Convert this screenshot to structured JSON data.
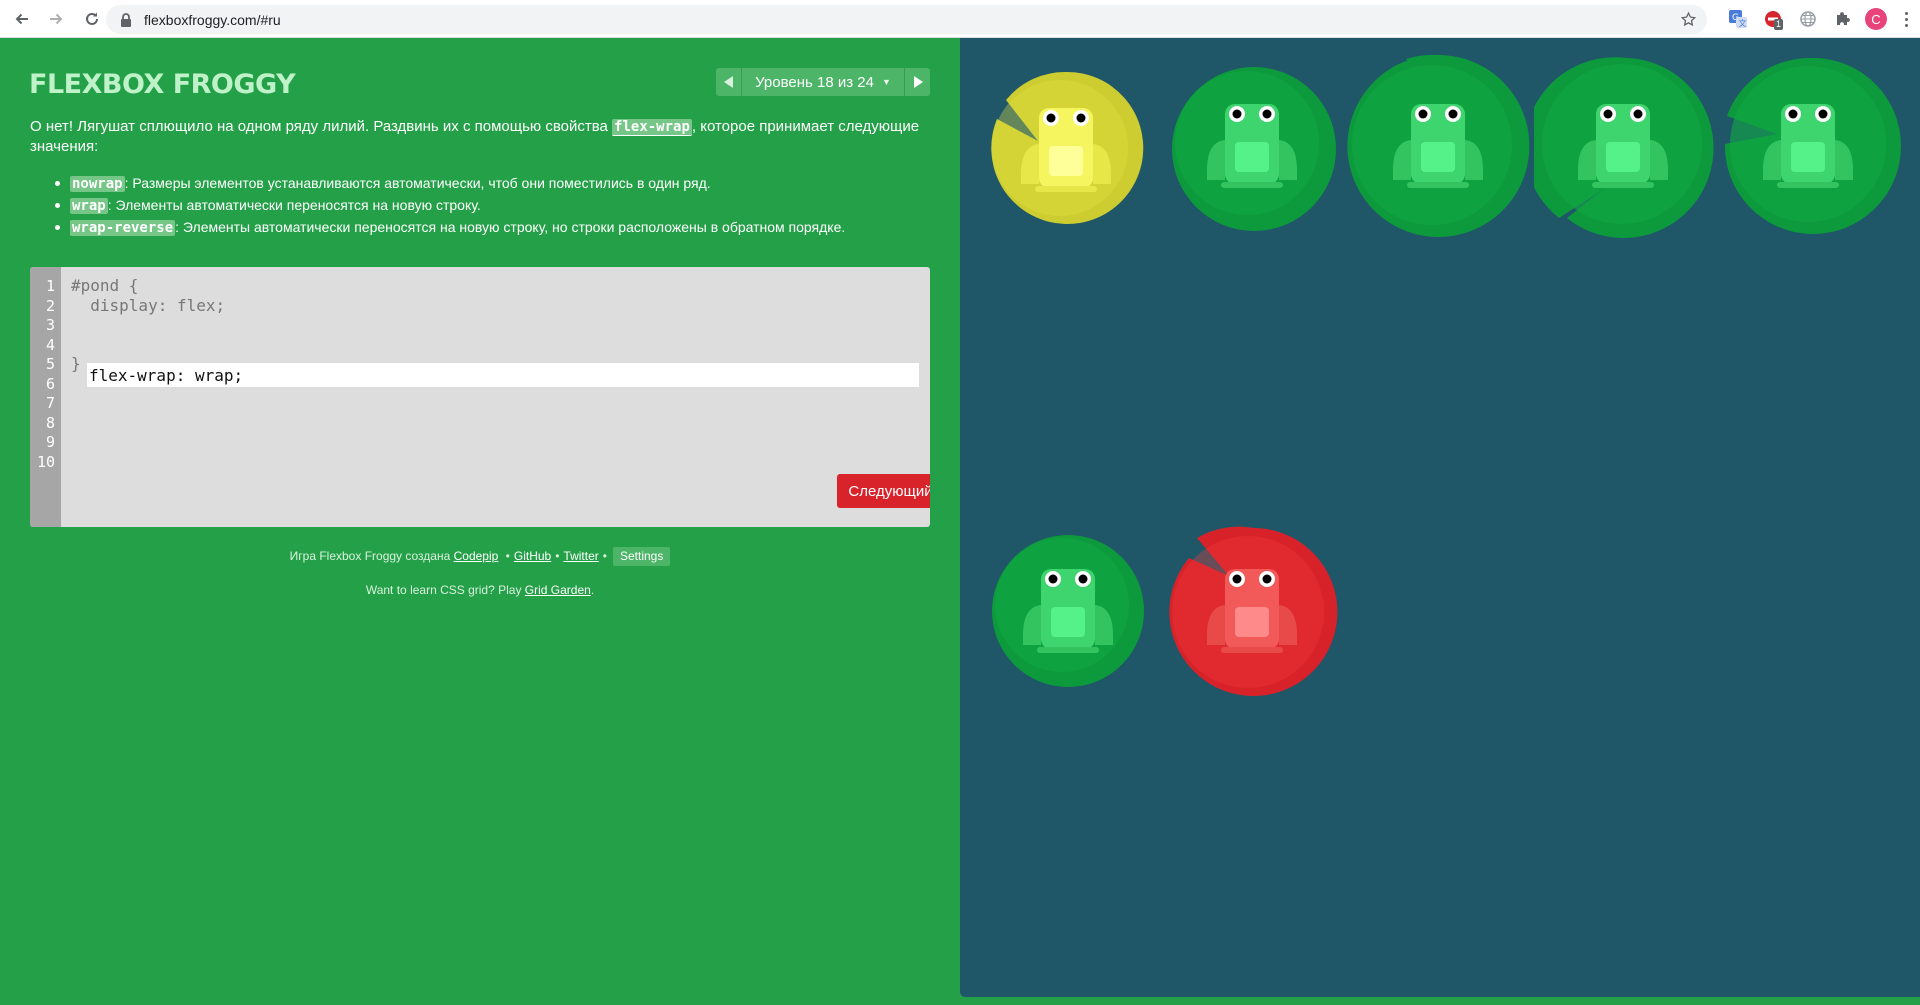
{
  "browser": {
    "url": "flexboxfroggy.com/#ru",
    "profile_initial": "C",
    "icons": [
      "back-icon",
      "forward-icon",
      "reload-icon",
      "lock-icon",
      "star-icon",
      "translate-extension-icon",
      "adblock-extension-icon",
      "globe-extension-icon",
      "puzzle-extensions-icon",
      "menu-icon"
    ],
    "adblock_badge": "1"
  },
  "game": {
    "logo": "FLEXBOX FROGGY",
    "level": {
      "label": "Уровень 18 из 24",
      "current": 18,
      "total": 24
    },
    "instructions": {
      "intro_before": "О нет! Лягушат сплющило на одном ряду лилий. Раздвинь их с помощью свойства ",
      "intro_property": "flex-wrap",
      "intro_after": ", которое принимает следующие значения:",
      "values": [
        {
          "code": "nowrap",
          "text": ": Размеры элементов устанавливаются автоматически, чтоб они поместились в один ряд."
        },
        {
          "code": "wrap",
          "text": ": Элементы автоматически переносятся на новую строку."
        },
        {
          "code": "wrap-reverse",
          "text": ": Элементы автоматически переносятся на новую строку, но строки расположены в обратном порядке."
        }
      ]
    },
    "editor": {
      "line_numbers": [
        "1",
        "2",
        "3",
        "4",
        "5",
        "6",
        "7",
        "8",
        "9",
        "10"
      ],
      "line1": "#pond {",
      "line2": "  display: flex;",
      "input_value": "flex-wrap: wrap;",
      "line4": "}",
      "next_button": "Следующий"
    },
    "credits": {
      "prefix": "Игра Flexbox Froggy создана",
      "codepip": "Codepip",
      "github": "GitHub",
      "twitter": "Twitter",
      "sep": "•",
      "settings": "Settings"
    },
    "promo": {
      "prefix": "Want to learn CSS grid? Play",
      "link": "Grid Garden",
      "suffix": "."
    }
  },
  "pond": {
    "background": "#1f5768",
    "lilypads": [
      "yellow",
      "green",
      "green",
      "green",
      "green",
      "green",
      "red"
    ],
    "frogs": [
      "yellow",
      "green",
      "green",
      "green",
      "green",
      "green",
      "red"
    ]
  },
  "colors": {
    "panel": "#24a148",
    "button": "#d9232b",
    "yellow_pad": "#cccc33",
    "yellow_frog": "#f5f560",
    "green_pad": "#0e9c3e",
    "green_frog": "#3ed56e",
    "red_pad": "#d8222a",
    "red_frog": "#f25a5a"
  }
}
